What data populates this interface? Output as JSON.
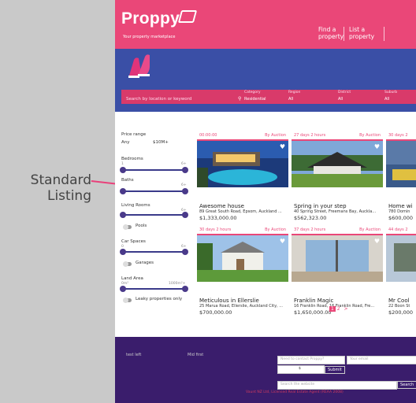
{
  "annotation": {
    "label": "Standard Listing"
  },
  "brand": {
    "logo": "Proppy",
    "tagline": "Your property marketplace",
    "accent": "#ea4778",
    "hero": "#3a4fa6",
    "footer": "#3a1d6c"
  },
  "nav": {
    "items": [
      {
        "label": "Find a property"
      },
      {
        "label": "List a property"
      }
    ]
  },
  "search": {
    "placeholder": "Search by location or keyword",
    "icon": "search-icon",
    "fields": [
      {
        "caption": "Category",
        "value": "Residential"
      },
      {
        "caption": "Region",
        "value": "All"
      },
      {
        "caption": "District",
        "value": "All"
      },
      {
        "caption": "Suburb",
        "value": "All"
      }
    ]
  },
  "filters": {
    "price_range": {
      "label": "Price range",
      "min": "Any",
      "max": "$10M+"
    },
    "bedrooms": {
      "label": "Bedrooms",
      "min": "1",
      "max": "6+"
    },
    "baths": {
      "label": "Baths",
      "min": "1",
      "max": "6+"
    },
    "living": {
      "label": "Living Rooms",
      "min": "1",
      "max": "6+"
    },
    "pools": {
      "label": "Pools"
    },
    "car": {
      "label": "Car Spaces",
      "min": "0",
      "max": "6+"
    },
    "garages": {
      "label": "Garages"
    },
    "land": {
      "label": "Land Area",
      "min": "0m²",
      "max": "1000m²+"
    },
    "leaky": {
      "label": "Leaky properties only"
    }
  },
  "listings": [
    {
      "time": "00:00:00",
      "type": "By Auction",
      "title": "Awesome house",
      "address": "89 Great South Road, Epsom, Auckland ...",
      "price": "$1,333,000.00"
    },
    {
      "time": "27 days 2 hours",
      "type": "By Auction",
      "title": "Spring in your step",
      "address": "40 Spring Street, Freemans Bay, Auckla...",
      "price": "$562,323.00"
    },
    {
      "time": "30 days 2",
      "type": "",
      "title": "Home wi",
      "address": "780 Domin",
      "price": "$600,000"
    },
    {
      "time": "30 days 2 hours",
      "type": "By Auction",
      "title": "Meticulous in Ellerslie",
      "address": "25 Marua Road, Ellerslie, Auckland City, ...",
      "price": "$700,000.00"
    },
    {
      "time": "37 days 2 hours",
      "type": "By Auction",
      "title": "Franklin Magic",
      "address": "16 Franklin Road, 16 Franklin Road, Fre...",
      "price": "$1,650,000.00"
    },
    {
      "time": "44 days 2",
      "type": "",
      "title": "Mr Cool",
      "address": "22 Boon St",
      "price": "$200,000"
    }
  ],
  "pagination": {
    "current": "1",
    "next": "2",
    "arrow": ">"
  },
  "footer": {
    "col1": "test left",
    "col2": "Mid first",
    "contact_placeholder": "Need to contact Proppy?",
    "email_placeholder": "Your email",
    "captcha": "$",
    "submit": "Submit",
    "search_placeholder": "Search the website",
    "search_button": "Search",
    "copyright": "Vaunt NZ Ltd, Licensed Real Estate Agent (REAA 2008)"
  }
}
